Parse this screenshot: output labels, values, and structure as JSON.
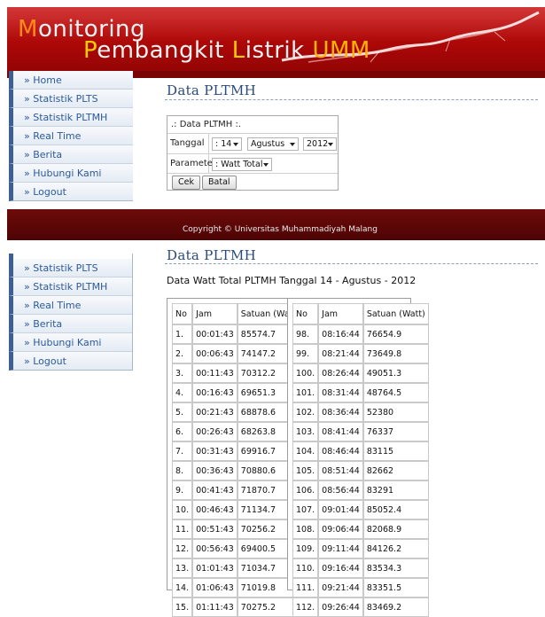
{
  "banner": {
    "title_first_letter": "M",
    "title_rest": "onitoring",
    "line2_p": "P",
    "line2_embangkit": "embangkit ",
    "line2_l": "L",
    "line2_istrik": "istrik ",
    "line2_umm": "UMM"
  },
  "menu_top": [
    {
      "label": "» Home"
    },
    {
      "label": "» Statistik PLTS"
    },
    {
      "label": "» Statistik PLTMH"
    },
    {
      "label": "» Real Time"
    },
    {
      "label": "» Berita"
    },
    {
      "label": "» Hubungi Kami"
    },
    {
      "label": "» Logout"
    }
  ],
  "menu_bottom": [
    {
      "label": "» Statistik PLTS"
    },
    {
      "label": "» Statistik PLTMH"
    },
    {
      "label": "» Real Time"
    },
    {
      "label": "» Berita"
    },
    {
      "label": "» Hubungi Kami"
    },
    {
      "label": "» Logout"
    }
  ],
  "page_title": "Data PLTMH",
  "form": {
    "header": ".: Data PLTMH :.",
    "tanggal_label": "Tanggal",
    "day": ": 14",
    "month": "Agustus",
    "year": "2012",
    "parameter_label": "Parameter",
    "parameter_value": ": Watt Total",
    "cek_label": "Cek",
    "batal_label": "Batal"
  },
  "footer": {
    "copyright": "Copyright © Universitas Muhammadiyah Malang"
  },
  "result_title": "Data PLTMH",
  "result_caption": "Data Watt Total PLTMH Tanggal 14 - Agustus - 2012",
  "table": {
    "headers": [
      "No",
      "Jam",
      "Satuan (Watt)"
    ],
    "left": [
      [
        "1.",
        "00:01:43",
        "85574.7"
      ],
      [
        "2.",
        "00:06:43",
        "74147.2"
      ],
      [
        "3.",
        "00:11:43",
        "70312.2"
      ],
      [
        "4.",
        "00:16:43",
        "69651.3"
      ],
      [
        "5.",
        "00:21:43",
        "68878.6"
      ],
      [
        "6.",
        "00:26:43",
        "68263.8"
      ],
      [
        "7.",
        "00:31:43",
        "69916.7"
      ],
      [
        "8.",
        "00:36:43",
        "70880.6"
      ],
      [
        "9.",
        "00:41:43",
        "71870.7"
      ],
      [
        "10.",
        "00:46:43",
        "71134.7"
      ],
      [
        "11.",
        "00:51:43",
        "70256.2"
      ],
      [
        "12.",
        "00:56:43",
        "69400.5"
      ],
      [
        "13.",
        "01:01:43",
        "71034.7"
      ],
      [
        "14.",
        "01:06:43",
        "71019.8"
      ],
      [
        "15.",
        "01:11:43",
        "70275.2"
      ]
    ],
    "right": [
      [
        "98.",
        "08:16:44",
        "76654.9"
      ],
      [
        "99.",
        "08:21:44",
        "73649.8"
      ],
      [
        "100.",
        "08:26:44",
        "49051.3"
      ],
      [
        "101.",
        "08:31:44",
        "48764.5"
      ],
      [
        "102.",
        "08:36:44",
        "52380"
      ],
      [
        "103.",
        "08:41:44",
        "76337"
      ],
      [
        "104.",
        "08:46:44",
        "83115"
      ],
      [
        "105.",
        "08:51:44",
        "82662"
      ],
      [
        "106.",
        "08:56:44",
        "83291"
      ],
      [
        "107.",
        "09:01:44",
        "85052.4"
      ],
      [
        "108.",
        "09:06:44",
        "82068.9"
      ],
      [
        "109.",
        "09:11:44",
        "84126.2"
      ],
      [
        "110.",
        "09:16:44",
        "83534.3"
      ],
      [
        "111.",
        "09:21:44",
        "83351.5"
      ],
      [
        "112.",
        "09:26:44",
        "83469.2"
      ]
    ]
  }
}
